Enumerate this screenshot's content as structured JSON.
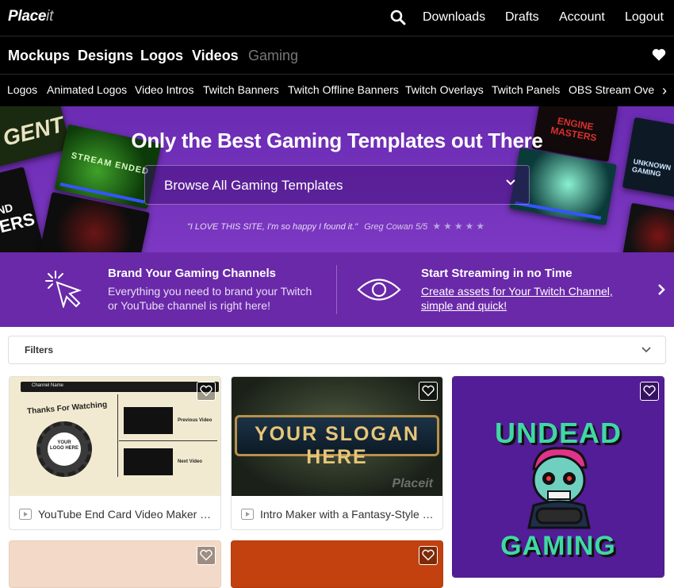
{
  "brand": {
    "name_main": "Place",
    "name_tail": "it"
  },
  "top_nav": {
    "downloads": "Downloads",
    "drafts": "Drafts",
    "account": "Account",
    "logout": "Logout"
  },
  "categories": {
    "mockups": "Mockups",
    "designs": "Designs",
    "logos": "Logos",
    "videos": "Videos",
    "gaming": "Gaming"
  },
  "subnav": [
    "Logos",
    "Animated Logos",
    "Video Intros",
    "Twitch Banners",
    "Twitch Offline Banners",
    "Twitch Overlays",
    "Twitch Panels",
    "OBS Stream Overlays"
  ],
  "hero": {
    "title": "Only the Best Gaming Templates out There",
    "browse_label": "Browse All Gaming Templates",
    "quote": "\"I LOVE THIS SITE, I'm so happy I found it.\"",
    "quote_author": "Greg Cowan 5/5",
    "stars": "★★★★★",
    "tile_texts": {
      "stream_ended": "STREAM ENDED",
      "gent": "GENT",
      "engine_masters": "ENGINE MASTERS",
      "unknown": "UNKNOWN GAMING",
      "nd": "ND",
      "ers": "ERS"
    }
  },
  "features": [
    {
      "title": "Brand Your Gaming Channels",
      "line1": "Everything you need to brand your Twitch",
      "line2": "or YouTube channel is right here!"
    },
    {
      "title": "Start Streaming in no Time",
      "line1": "Create assets for Your Twitch Channel,",
      "line2": "simple and quick!"
    }
  ],
  "filters": {
    "label": "Filters"
  },
  "cards": [
    {
      "caption": "YouTube End Card Video Maker for Gamers",
      "thumb": {
        "header": "Channel Name",
        "thanks": "Thanks For Watching",
        "logo": "YOUR LOGO HERE",
        "prev": "Previous Video",
        "next": "Next Video"
      }
    },
    {
      "caption": "Intro Maker with a Fantasy-Style Slogan",
      "thumb": {
        "slogan": "YOUR SLOGAN HERE",
        "watermark": "Placeit"
      }
    },
    {
      "caption": "",
      "thumb": {
        "line1": "UNDEAD",
        "line2": "GAMING"
      }
    }
  ],
  "colors": {
    "hero_purple": "#6b2bb3",
    "feature_purple": "#6a29a9",
    "nav_black": "#000000"
  }
}
